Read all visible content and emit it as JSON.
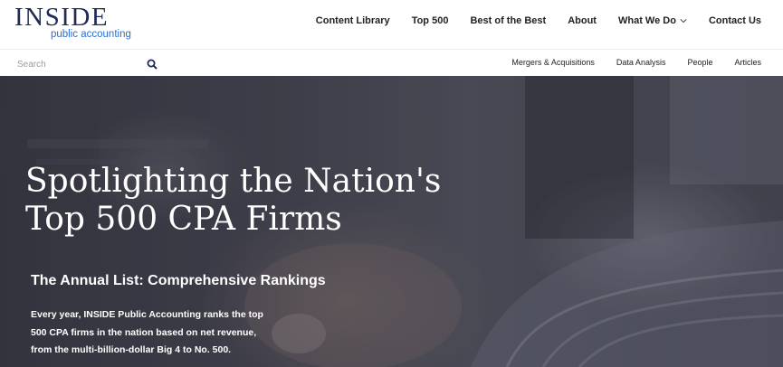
{
  "header": {
    "logo_main": "INSIDE",
    "logo_sub": "public accounting",
    "nav": [
      {
        "label": "Content Library"
      },
      {
        "label": "Top 500"
      },
      {
        "label": "Best of the Best"
      },
      {
        "label": "About"
      },
      {
        "label": "What We Do",
        "has_dropdown": true,
        "icon": "chevron-down-icon"
      },
      {
        "label": "Contact Us"
      }
    ]
  },
  "subbar": {
    "search_placeholder": "Search",
    "search_icon": "search-icon",
    "links": [
      {
        "label": "Mergers & Acquisitions"
      },
      {
        "label": "Data Analysis"
      },
      {
        "label": "People"
      },
      {
        "label": "Articles"
      }
    ]
  },
  "hero": {
    "title_line1": "Spotlighting the Nation's",
    "title_line2": "Top 500 CPA Firms",
    "subhead_bold": "The Annual List:",
    "subhead_rest": " Comprehensive Rankings",
    "body": "Every year, INSIDE Public Accounting ranks the top 500 CPA firms in the nation based on net revenue, from the multi-billion-dollar Big 4 to No. 500."
  },
  "colors": {
    "logo_navy": "#1f2a55",
    "logo_blue": "#2a6fd1",
    "hero_overlay": "#4a4b58"
  }
}
